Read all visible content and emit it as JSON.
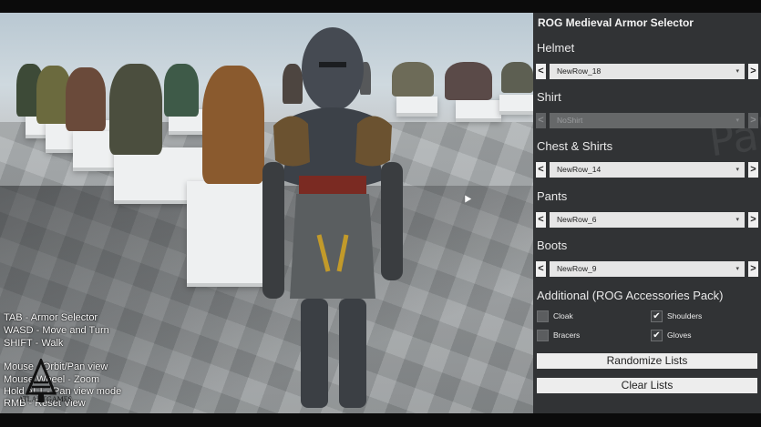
{
  "panel": {
    "title": "ROG Medieval Armor Selector",
    "watermark": "Pal",
    "sections": [
      {
        "label": "Helmet",
        "value": "NewRow_18",
        "enabled": true
      },
      {
        "label": "Shirt",
        "value": "NoShirt",
        "enabled": false
      },
      {
        "label": "Chest & Shirts",
        "value": "NewRow_14",
        "enabled": true
      },
      {
        "label": "Pants",
        "value": "NewRow_6",
        "enabled": true
      },
      {
        "label": "Boots",
        "value": "NewRow_9",
        "enabled": true
      }
    ],
    "prev_glyph": "<",
    "next_glyph": ">",
    "dropdown_glyph": "▾",
    "additional_label": "Additional (ROG Accessories Pack)",
    "accessories": [
      {
        "label": "Cloak",
        "checked": false
      },
      {
        "label": "Shoulders",
        "checked": true
      },
      {
        "label": "Bracers",
        "checked": false
      },
      {
        "label": "Gloves",
        "checked": true
      }
    ],
    "check_glyph": "✔",
    "randomize_label": "Randomize Lists",
    "clear_label": "Clear Lists"
  },
  "hud": {
    "lines": [
      "TAB - Armor Selector",
      "WASD - Move and Turn",
      "SHIFT - Walk",
      "",
      "Mouse - Orbit/Pan view",
      "Mouse Wheel - Zoom",
      "Hold ALT - Pan view mode",
      "RMB - Reset View"
    ],
    "logo_text": "ATLANTGAMES"
  },
  "colors": {
    "panel_bg": "#343638",
    "button_bg": "#ededed",
    "letterbox": "#0b0b0b"
  }
}
